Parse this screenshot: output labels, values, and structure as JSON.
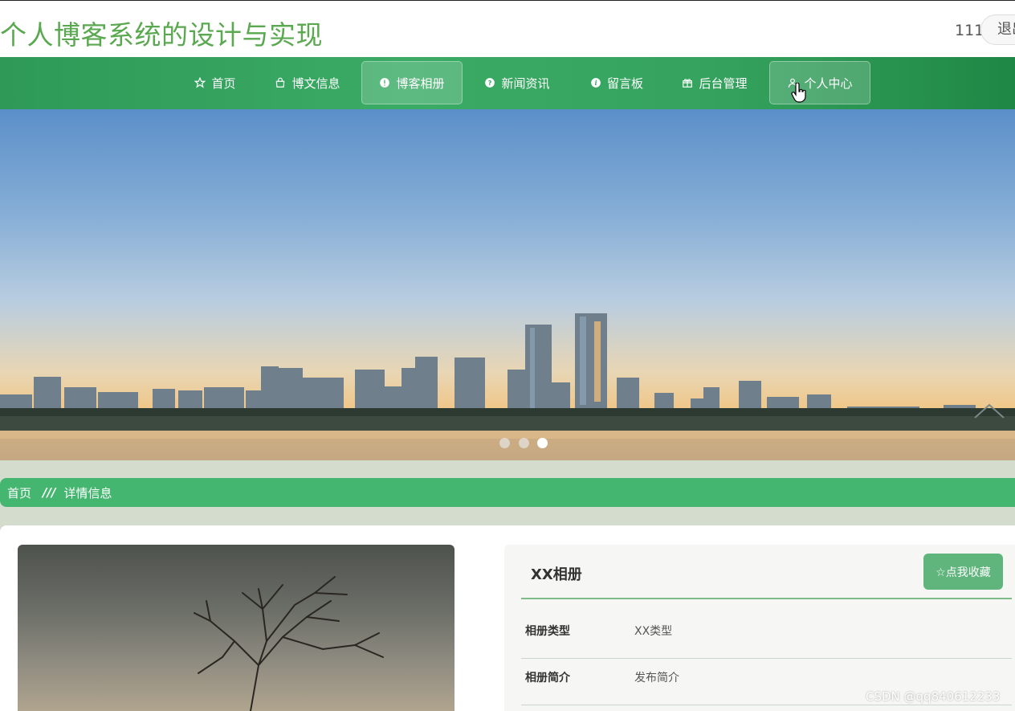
{
  "header": {
    "site_title": "个人博客系统的设计与实现",
    "user_name": "111",
    "logout_label": "退出"
  },
  "nav": {
    "items": [
      {
        "label": "首页",
        "icon": "star-icon"
      },
      {
        "label": "博文信息",
        "icon": "bag-icon"
      },
      {
        "label": "博客相册",
        "icon": "info-circle-icon"
      },
      {
        "label": "新闻资讯",
        "icon": "question-circle-icon"
      },
      {
        "label": "留言板",
        "icon": "info-icon"
      },
      {
        "label": "后台管理",
        "icon": "gift-icon"
      },
      {
        "label": "个人中心",
        "icon": "user-icon"
      }
    ]
  },
  "carousel": {
    "slide_count": 3,
    "active_index": 2
  },
  "breadcrumb": {
    "home": "首页",
    "separator": "///",
    "current": "详情信息"
  },
  "detail": {
    "title": "XX相册",
    "favorite_label": "☆点我收藏",
    "rows": [
      {
        "label": "相册类型",
        "value": "XX类型"
      },
      {
        "label": "相册简介",
        "value": "发布简介"
      }
    ]
  },
  "watermark": "CSDN @qq840612233",
  "colors": {
    "brand_green": "#45b670",
    "title_green": "#5aa84f",
    "nav_green": "#35a35e"
  }
}
